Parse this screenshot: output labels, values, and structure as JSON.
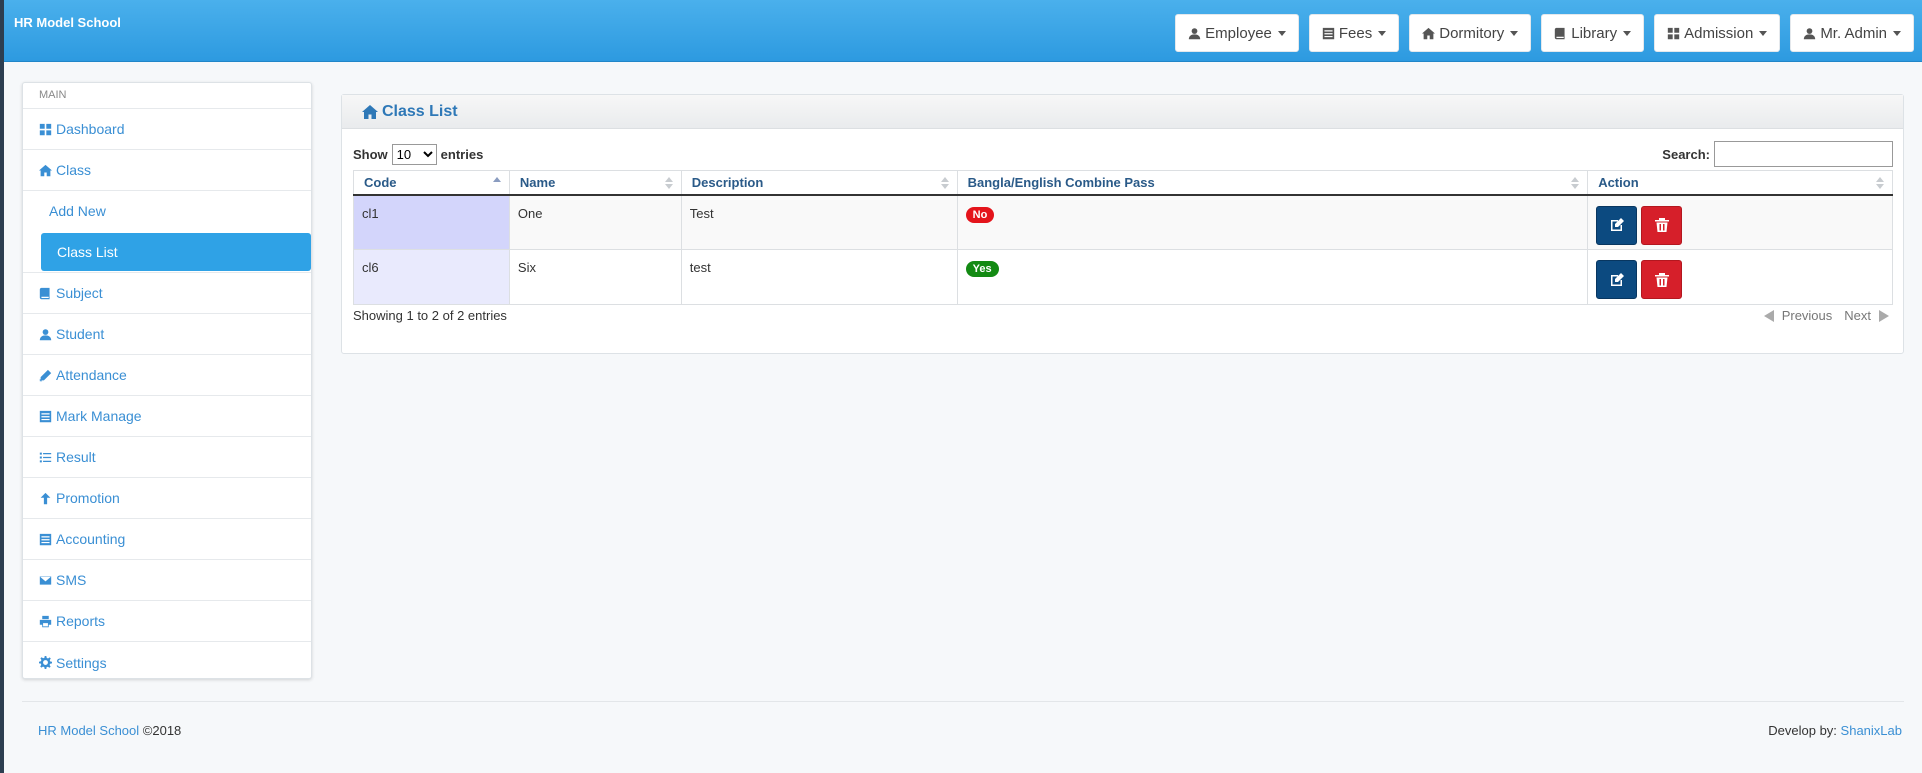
{
  "app": {
    "brand": "HR Model School"
  },
  "topnav": [
    {
      "label": "Employee",
      "icon": "user-icon"
    },
    {
      "label": "Fees",
      "icon": "list-icon"
    },
    {
      "label": "Dormitory",
      "icon": "home-icon"
    },
    {
      "label": "Library",
      "icon": "book-icon"
    },
    {
      "label": "Admission",
      "icon": "grid-icon"
    },
    {
      "label": "Mr. Admin",
      "icon": "user-icon"
    }
  ],
  "sidebar": {
    "heading": "MAIN",
    "items": [
      {
        "label": "Dashboard",
        "icon": "grid-icon"
      },
      {
        "label": "Class",
        "icon": "home-icon"
      },
      {
        "label": "Add New"
      },
      {
        "label": "Class List",
        "active": true
      },
      {
        "label": "Subject",
        "icon": "book-icon"
      },
      {
        "label": "Student",
        "icon": "user-icon"
      },
      {
        "label": "Attendance",
        "icon": "pencil-icon"
      },
      {
        "label": "Mark Manage",
        "icon": "list-icon"
      },
      {
        "label": "Result",
        "icon": "list-bullet-icon"
      },
      {
        "label": "Promotion",
        "icon": "arrow-up-icon"
      },
      {
        "label": "Accounting",
        "icon": "list-icon"
      },
      {
        "label": "SMS",
        "icon": "envelope-icon"
      },
      {
        "label": "Reports",
        "icon": "print-icon"
      },
      {
        "label": "Settings",
        "icon": "gear-icon"
      }
    ]
  },
  "panel": {
    "title": "Class List",
    "show_label": "Show",
    "length_value": "10",
    "entries_label": "entries",
    "search_label": "Search:",
    "search_value": "",
    "columns": [
      "Code",
      "Name",
      "Description",
      "Bangla/English Combine Pass",
      "Action"
    ],
    "rows": [
      {
        "code": "cl1",
        "name": "One",
        "description": "Test",
        "combine_pass": "No"
      },
      {
        "code": "cl6",
        "name": "Six",
        "description": "test",
        "combine_pass": "Yes"
      }
    ],
    "info": "Showing 1 to 2 of 2 entries",
    "prev_label": "Previous",
    "next_label": "Next"
  },
  "footer": {
    "school_link": "HR Model School",
    "year": "©2018",
    "develop_label": "Develop by:",
    "developer_link": "ShanixLab"
  },
  "colors": {
    "header": "#2d9ae0",
    "active_item": "#2fa2e6",
    "badge_no": "#e4141b",
    "badge_yes": "#138a13",
    "edit_button": "#0c4a80",
    "delete_button": "#d61f2a"
  }
}
